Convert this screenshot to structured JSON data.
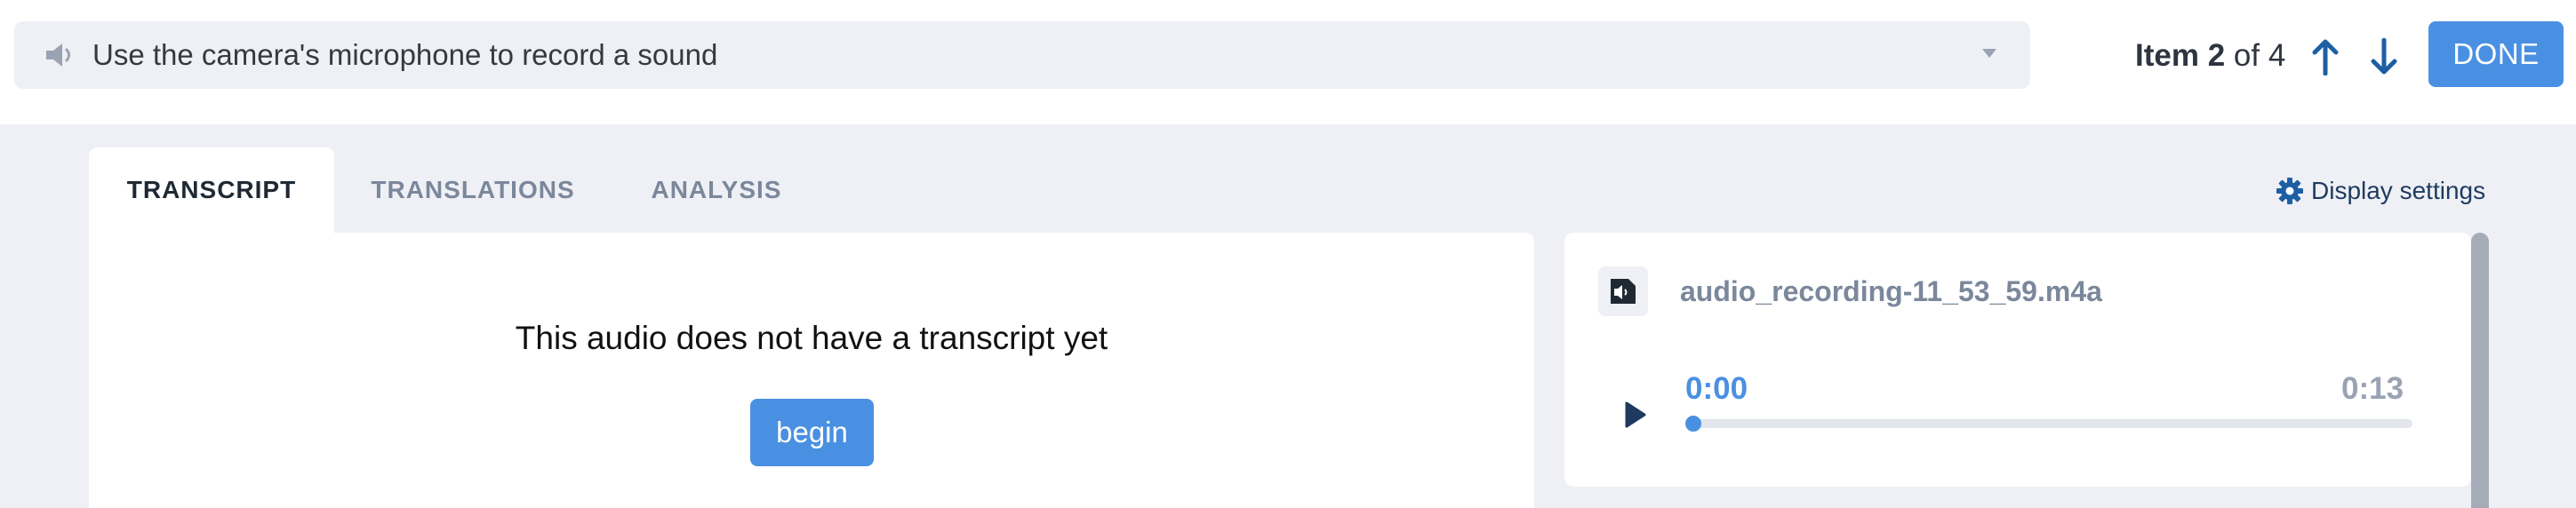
{
  "header": {
    "question_label": "Use the camera's microphone to record a sound",
    "item_prefix": "Item",
    "item_current": "2",
    "item_of": "of 4",
    "done_label": "DONE"
  },
  "tabs": [
    {
      "label": "TRANSCRIPT",
      "active": true
    },
    {
      "label": "TRANSLATIONS",
      "active": false
    },
    {
      "label": "ANALYSIS",
      "active": false
    }
  ],
  "display_settings_label": "Display settings",
  "transcript": {
    "empty_message": "This audio does not have a transcript yet",
    "begin_label": "begin"
  },
  "audio": {
    "file_name": "audio_recording-11_53_59.m4a",
    "current_time": "0:00",
    "total_time": "0:13",
    "progress": 0
  },
  "colors": {
    "accent": "#4a90e2",
    "background": "#eef0f5",
    "muted_text": "#7b879b",
    "dark_text": "#1f2933"
  },
  "icons": {
    "question_type": "speaker-icon",
    "settings": "gear-icon",
    "file": "audio-file-icon",
    "play": "play-icon"
  }
}
